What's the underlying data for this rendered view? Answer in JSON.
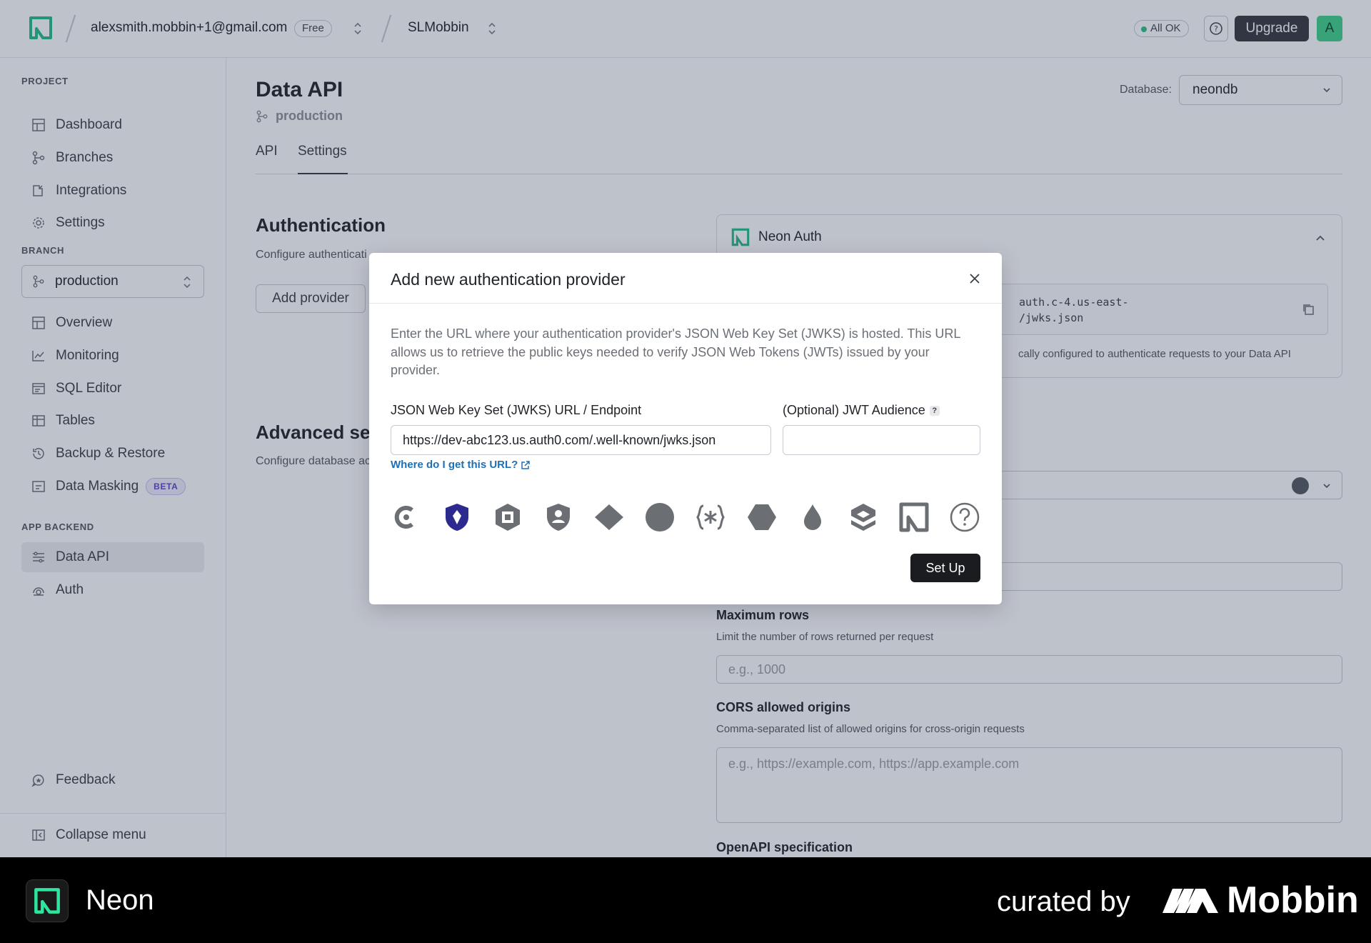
{
  "topbar": {
    "account_email": "alexsmith.mobbin+1@gmail.com",
    "plan_badge": "Free",
    "project_name": "SLMobbin",
    "status": "All OK",
    "help_icon": "question-circle-icon",
    "upgrade_label": "Upgrade",
    "avatar_initial": "A",
    "colors": {
      "brand": "#00e599",
      "avatar": "#3fd18a",
      "status_dot": "#2ec27e"
    }
  },
  "sidebar": {
    "project_label": "PROJECT",
    "project_items": [
      {
        "label": "Dashboard",
        "icon": "dashboard-icon"
      },
      {
        "label": "Branches",
        "icon": "branches-icon"
      },
      {
        "label": "Integrations",
        "icon": "integrations-icon"
      },
      {
        "label": "Settings",
        "icon": "gear-icon"
      }
    ],
    "branch_label": "BRANCH",
    "branch_value": "production",
    "branch_items": [
      {
        "label": "Overview",
        "icon": "overview-icon"
      },
      {
        "label": "Monitoring",
        "icon": "chart-icon"
      },
      {
        "label": "SQL Editor",
        "icon": "sql-editor-icon"
      },
      {
        "label": "Tables",
        "icon": "table-icon"
      },
      {
        "label": "Backup & Restore",
        "icon": "history-icon"
      },
      {
        "label": "Data Masking",
        "icon": "mask-icon",
        "badge": "BETA"
      }
    ],
    "backend_label": "APP BACKEND",
    "backend_items": [
      {
        "label": "Data API",
        "icon": "data-api-icon",
        "active": true
      },
      {
        "label": "Auth",
        "icon": "auth-icon"
      }
    ],
    "feedback_label": "Feedback",
    "collapse_label": "Collapse menu"
  },
  "main": {
    "title": "Data API",
    "branch": "production",
    "database_label": "Database:",
    "database_value": "neondb",
    "tabs": [
      {
        "label": "API",
        "active": false
      },
      {
        "label": "Settings",
        "active": true
      }
    ],
    "auth_title": "Authentication",
    "auth_subtitle": "Configure authenticati",
    "add_provider_label": "Add provider",
    "advanced_title": "Advanced se",
    "advanced_subtitle": "Configure database ac",
    "neon_auth": {
      "title": "Neon Auth",
      "code_line1": "auth.c-4.us-east-",
      "code_line2": "/jwks.json",
      "note": "cally configured to authenticate requests to your Data API"
    },
    "max_rows": {
      "label": "Maximum rows",
      "help": "Limit the number of rows returned per request",
      "placeholder": "e.g., 1000"
    },
    "cors": {
      "label": "CORS allowed origins",
      "help": "Comma-separated list of allowed origins for cross-origin requests",
      "placeholder": "e.g., https://example.com, https://app.example.com"
    },
    "openapi_label": "OpenAPI specification"
  },
  "modal": {
    "title": "Add new authentication provider",
    "description": "Enter the URL where your authentication provider's JSON Web Key Set (JWKS) is hosted. This URL allows us to retrieve the public keys needed to verify JSON Web Tokens (JWTs) issued by your provider.",
    "jwks_label": "JSON Web Key Set (JWKS) URL / Endpoint",
    "jwks_value": "https://dev-abc123.us.auth0.com/.well-known/jwks.json",
    "audience_label": "(Optional) JWT Audience",
    "audience_help": "?",
    "audience_value": "",
    "help_link": "Where do I get this URL?",
    "providers": [
      "clerk-icon",
      "stytch-icon",
      "descope-icon",
      "auth0-shield-icon",
      "diamond-provider-icon",
      "circle-provider-icon",
      "custom-jwt-icon",
      "hexagon-provider-icon",
      "drop-provider-icon",
      "stack-auth-icon",
      "neon-auth-icon",
      "other-provider-icon"
    ],
    "setup_label": "Set Up"
  },
  "footer": {
    "app_name": "Neon",
    "curated_by": "curated by",
    "brand": "Mobbin"
  }
}
